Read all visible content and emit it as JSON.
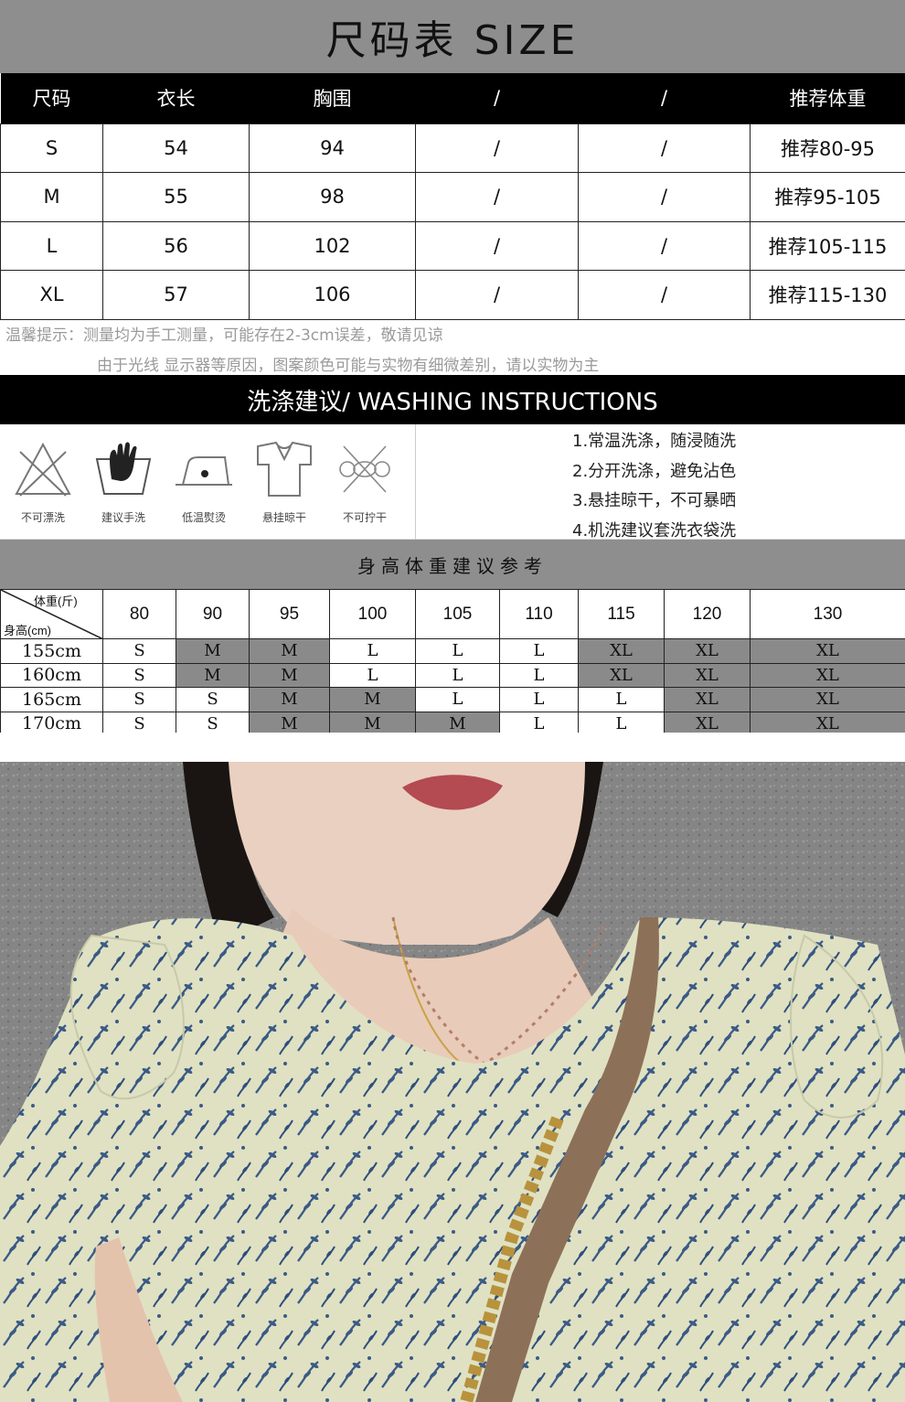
{
  "size_chart": {
    "title": "尺码表 SIZE",
    "headers": [
      "尺码",
      "衣长",
      "胸围",
      "/",
      "/",
      "推荐体重"
    ],
    "rows": [
      [
        "S",
        "54",
        "94",
        "/",
        "/",
        "推荐80-95"
      ],
      [
        "M",
        "55",
        "98",
        "/",
        "/",
        "推荐95-105"
      ],
      [
        "L",
        "56",
        "102",
        "/",
        "/",
        "推荐105-115"
      ],
      [
        "XL",
        "57",
        "106",
        "/",
        "/",
        "推荐115-130"
      ]
    ],
    "note_line1": "温馨提示：测量均为手工测量，可能存在2-3cm误差，敬请见谅",
    "note_line2": "由于光线 显示器等原因，图案颜色可能与实物有细微差别，请以实物为主"
  },
  "washing": {
    "title": "洗涤建议/ WASHING INSTRUCTIONS",
    "icons": [
      {
        "icon": "no-bleach-icon",
        "label": "不可漂洗"
      },
      {
        "icon": "hand-wash-icon",
        "label": "建议手洗"
      },
      {
        "icon": "low-iron-icon",
        "label": "低温熨烫"
      },
      {
        "icon": "hang-dry-icon",
        "label": "悬挂晾干"
      },
      {
        "icon": "no-wring-icon",
        "label": "不可拧干"
      }
    ],
    "instructions": [
      "1.常温洗涤，随浸随洗",
      "2.分开洗涤，避免沾色",
      "3.悬挂晾干，不可暴晒",
      "4.机洗建议套洗衣袋洗"
    ]
  },
  "height_weight": {
    "title": "身高体重建议参考",
    "corner_weight": "体重(斤)",
    "corner_height": "身高(cm)",
    "weights": [
      "80",
      "90",
      "95",
      "100",
      "105",
      "110",
      "115",
      "120",
      "130"
    ],
    "rows": [
      {
        "height": "155cm",
        "sizes": [
          "S",
          "M",
          "M",
          "L",
          "L",
          "L",
          "XL",
          "XL",
          "XL"
        ]
      },
      {
        "height": "160cm",
        "sizes": [
          "S",
          "M",
          "M",
          "L",
          "L",
          "L",
          "XL",
          "XL",
          "XL"
        ]
      },
      {
        "height": "165cm",
        "sizes": [
          "S",
          "S",
          "M",
          "M",
          "L",
          "L",
          "L",
          "XL",
          "XL"
        ]
      },
      {
        "height": "170cm",
        "sizes": [
          "S",
          "S",
          "M",
          "M",
          "M",
          "L",
          "L",
          "XL",
          "XL"
        ]
      }
    ],
    "shaded_sizes": [
      "M",
      "XL"
    ]
  },
  "colors": {
    "gray_band": "#8e8e8e",
    "shaded_cell": "#8a8a8a",
    "black_band": "#000000",
    "note_text": "#9a9a9a"
  }
}
